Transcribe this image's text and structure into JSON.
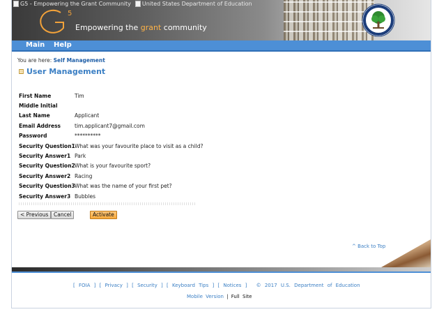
{
  "banner": {
    "g5_alt": "G5 - Empowering the Grant Community",
    "ed_alt": "United States Department of Education",
    "logo_text": "G",
    "logo_sup": "5",
    "tagline_pre": "Empowering the",
    "tagline_hl": "grant",
    "tagline_post": "community"
  },
  "nav": {
    "main": "Main",
    "help": "Help"
  },
  "breadcrumb": {
    "prefix": "You are here:",
    "current": "Self Management"
  },
  "page": {
    "title": "User Management"
  },
  "fields": [
    {
      "label": "First Name",
      "value": "Tim"
    },
    {
      "label": "Middle Initial",
      "value": ""
    },
    {
      "label": "Last Name",
      "value": "Applicant"
    },
    {
      "label": "Email Address",
      "value": "tim.applicant7@gmail.com"
    },
    {
      "label": "Password",
      "value": "**********"
    },
    {
      "label": "Security Question1",
      "value": "What was your favourite place to visit as a child?"
    },
    {
      "label": "Security Answer1",
      "value": "Park"
    },
    {
      "label": "Security Question2",
      "value": "What is your favourite sport?"
    },
    {
      "label": "Security Answer2",
      "value": "Racing"
    },
    {
      "label": "Security Question3",
      "value": "What was the name of your first pet?"
    },
    {
      "label": "Security Answer3",
      "value": "Bubbles"
    }
  ],
  "buttons": {
    "previous": "< Previous",
    "cancel": "Cancel",
    "activate": "Activate"
  },
  "back_to_top": "^ Back to Top",
  "footer": {
    "foia": "FOIA",
    "privacy": "Privacy",
    "security": "Security",
    "keyboard": "Keyboard Tips",
    "notices": "Notices",
    "copyright": "© 2017 U.S. Department of Education",
    "mobile": "Mobile Version",
    "divider": "|",
    "full": "Full",
    "site": "Site"
  },
  "colors": {
    "nav_blue": "#4d8fd6",
    "link_blue": "#3b7fc4",
    "activate_orange": "#f7a93d"
  },
  "icons": {
    "title": "table-icon",
    "seal": "department-seal-icon"
  }
}
